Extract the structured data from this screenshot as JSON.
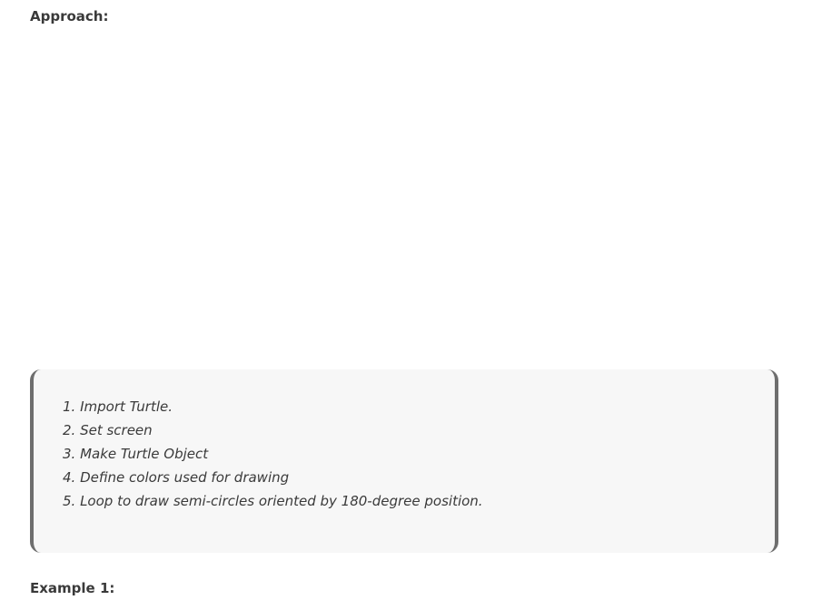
{
  "headings": {
    "approach": "Approach:",
    "example": "Example 1:"
  },
  "steps": [
    "1. Import Turtle.",
    "2. Set screen",
    "3. Make Turtle Object",
    "4. Define colors used for drawing",
    "5. Loop to draw semi-circles oriented by 180-degree position."
  ],
  "colors": {
    "box_background": "#f7f7f7",
    "box_border": "#6e6e6e",
    "text": "#3a3a3a"
  }
}
